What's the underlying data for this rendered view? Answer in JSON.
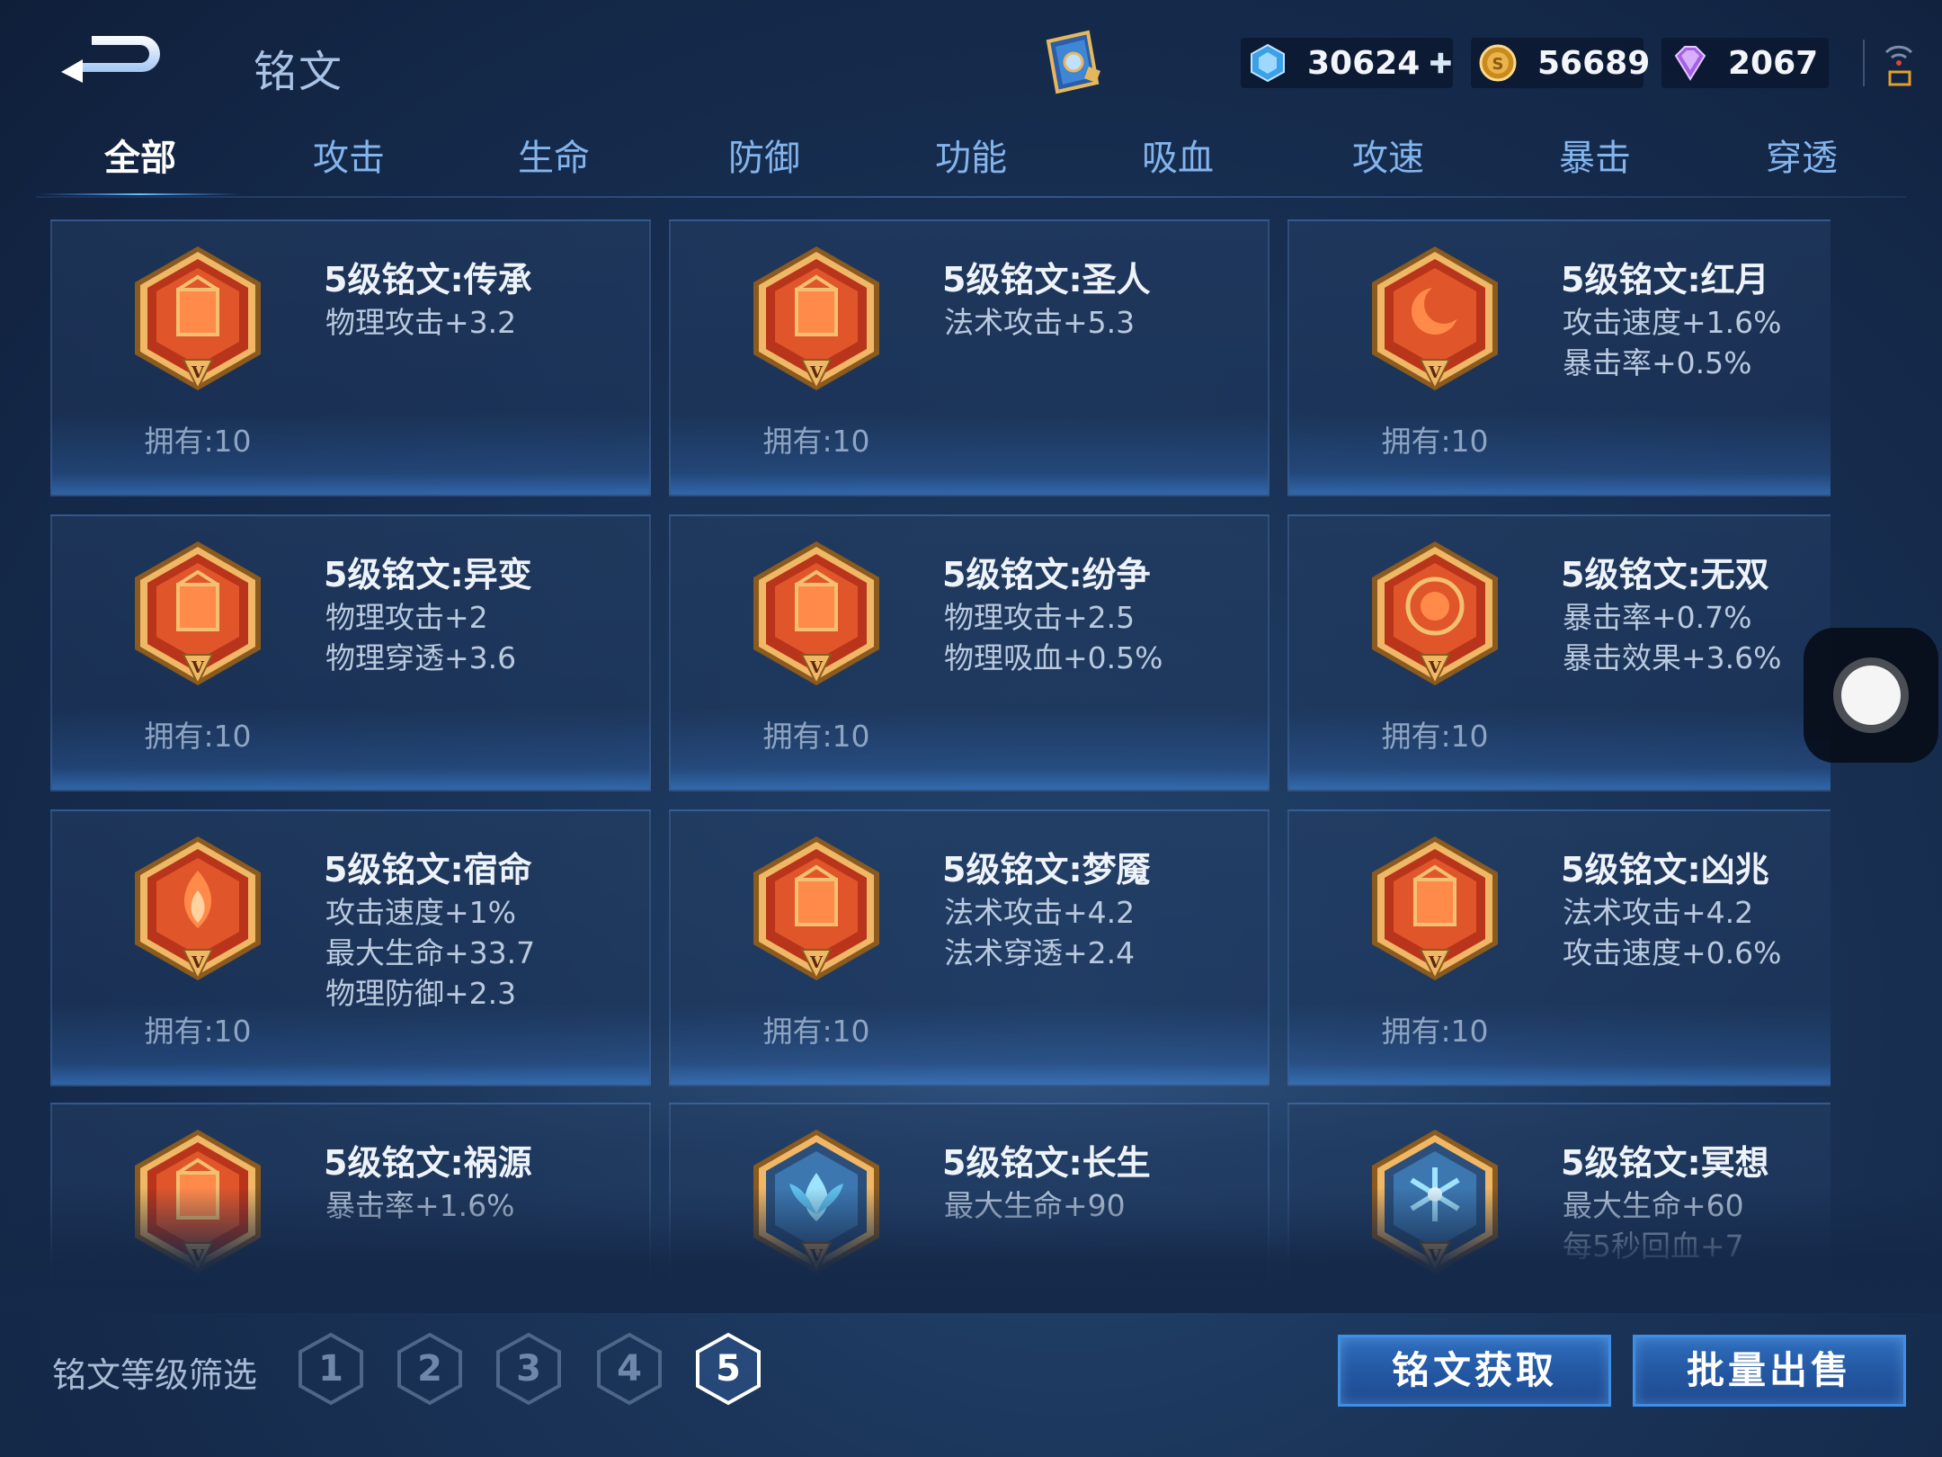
{
  "header": {
    "title": "铭文",
    "currencies": {
      "ticket": "30624",
      "gold": "56689",
      "gem": "2067"
    },
    "icons": {
      "back": "back-arrow-icon",
      "book": "inscription-book-icon",
      "ticket": "ticket-crystal-icon",
      "gold": "gold-coin-icon",
      "gem": "purple-gem-icon",
      "add": "plus-icon",
      "signal": "signal-icon"
    }
  },
  "tabs": [
    {
      "label": "全部",
      "active": true
    },
    {
      "label": "攻击"
    },
    {
      "label": "生命"
    },
    {
      "label": "防御"
    },
    {
      "label": "功能"
    },
    {
      "label": "吸血"
    },
    {
      "label": "攻速"
    },
    {
      "label": "暴击"
    },
    {
      "label": "穿透"
    }
  ],
  "cards": [
    {
      "name": "5级铭文:传承",
      "stats": [
        "物理攻击+3.2"
      ],
      "owned": "拥有:10",
      "color": "red"
    },
    {
      "name": "5级铭文:圣人",
      "stats": [
        "法术攻击+5.3"
      ],
      "owned": "拥有:10",
      "color": "red"
    },
    {
      "name": "5级铭文:红月",
      "stats": [
        "攻击速度+1.6%",
        "暴击率+0.5%"
      ],
      "owned": "拥有:10",
      "color": "red"
    },
    {
      "name": "5级铭文:异变",
      "stats": [
        "物理攻击+2",
        "物理穿透+3.6"
      ],
      "owned": "拥有:10",
      "color": "red"
    },
    {
      "name": "5级铭文:纷争",
      "stats": [
        "物理攻击+2.5",
        "物理吸血+0.5%"
      ],
      "owned": "拥有:10",
      "color": "red"
    },
    {
      "name": "5级铭文:无双",
      "stats": [
        "暴击率+0.7%",
        "暴击效果+3.6%"
      ],
      "owned": "拥有:10",
      "color": "red"
    },
    {
      "name": "5级铭文:宿命",
      "stats": [
        "攻击速度+1%",
        "最大生命+33.7",
        "物理防御+2.3"
      ],
      "owned": "拥有:10",
      "color": "red"
    },
    {
      "name": "5级铭文:梦魇",
      "stats": [
        "法术攻击+4.2",
        "法术穿透+2.4"
      ],
      "owned": "拥有:10",
      "color": "red"
    },
    {
      "name": "5级铭文:凶兆",
      "stats": [
        "法术攻击+4.2",
        "攻击速度+0.6%"
      ],
      "owned": "拥有:10",
      "color": "red"
    },
    {
      "name": "5级铭文:祸源",
      "stats": [
        "暴击率+1.6%"
      ],
      "owned": "",
      "color": "red"
    },
    {
      "name": "5级铭文:长生",
      "stats": [
        "最大生命+90"
      ],
      "owned": "",
      "color": "blue"
    },
    {
      "name": "5级铭文:冥想",
      "stats": [
        "最大生命+60",
        "每5秒回血+7"
      ],
      "owned": "",
      "color": "blue"
    }
  ],
  "filter": {
    "label": "铭文等级筛选",
    "levels": [
      "1",
      "2",
      "3",
      "4",
      "5"
    ],
    "active_level": "5"
  },
  "actions": {
    "get_label": "铭文获取",
    "sell_label": "批量出售"
  },
  "colors": {
    "accent": "#3d8ee6",
    "tab_inactive": "#84b4ec",
    "emblem_red": "#d9481f",
    "emblem_gold": "#e8b35a",
    "emblem_blue": "#2f5f93"
  }
}
